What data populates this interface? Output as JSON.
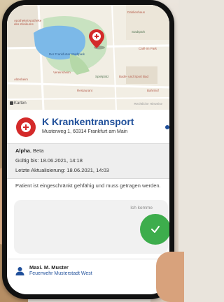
{
  "map": {
    "labels": {
      "apotheke": "Apotheke/Apotheke des Klinikums",
      "dahlienhaus": "Dahlienhaus",
      "stadtpark": "Stadtpark",
      "spielplatz": "Spielplatz",
      "vereinsheim": "Vereinsheim",
      "see": "Der Frankfurter Stadtpark",
      "altenheim": "Altenheim",
      "cafe": "Café im Park",
      "restaurant": "Restaurant",
      "bad": "Bade- und Sport Bad",
      "bahnhof": "Bahnhof"
    },
    "karten_label": "Karten",
    "footer": "Rechtliche Hinweise"
  },
  "header": {
    "title": "K Krankentransport",
    "address": "Musterweg 1, 60314 Frankfurt am Main"
  },
  "patient": {
    "name_bold": "Alpha",
    "name_rest": ", Beta",
    "valid_until": "Gültig bis: 18.06.2021, 14:18",
    "last_update": "Letzte Aktualisierung: 18.06.2021, 14:03"
  },
  "description": "Patient ist eingeschränkt gehfähig und muss getragen werden.",
  "action": {
    "label": "Ich komme"
  },
  "user": {
    "name": "Maxi. M. Muster",
    "org": "Feuerwehr Musterstadt West"
  },
  "colors": {
    "brand_blue": "#1f4f9a",
    "brand_red": "#d42a2a",
    "confirm_green": "#3dad4c"
  },
  "icons": {
    "map_pin": "map-pin-icon",
    "logo": "red-cross-logo",
    "confirm": "check-icon",
    "user": "user-icon"
  }
}
